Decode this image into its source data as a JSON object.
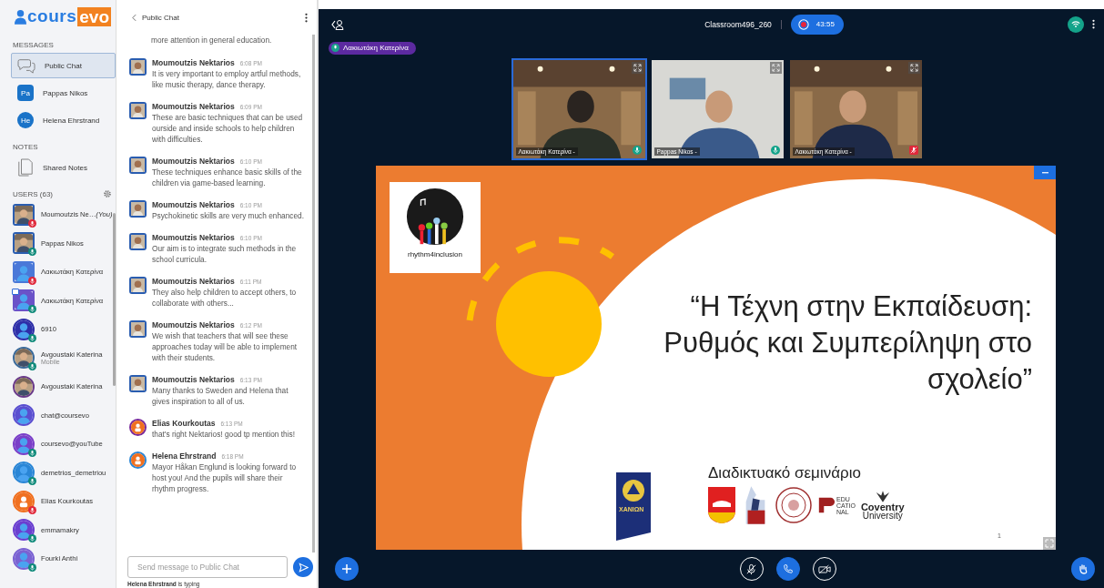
{
  "logo": {
    "part_a": "cours",
    "part_b": "evo"
  },
  "sidebar": {
    "messages_heading": "MESSAGES",
    "messages": [
      {
        "label": "Public Chat",
        "kind": "chat",
        "selected": true
      },
      {
        "label": "Pappas Nikos",
        "kind": "initials",
        "initials": "Pa",
        "moderator": true,
        "selected": false
      },
      {
        "label": "Helena Ehrstrand",
        "kind": "initials",
        "initials": "He",
        "moderator": false,
        "selected": false
      }
    ],
    "notes_heading": "NOTES",
    "notes": [
      {
        "label": "Shared Notes"
      }
    ],
    "users_heading": "USERS (63)",
    "users": [
      {
        "name": "Moumoutzis Ne…",
        "suffix": "(You)",
        "moderator": true,
        "color": "#2a5db0",
        "in_audio": true,
        "muted": true,
        "presenter": false
      },
      {
        "name": "Pappas Nikos",
        "moderator": true,
        "color": "#2a5db0",
        "in_audio": true,
        "muted": false,
        "presenter": false
      },
      {
        "name": "Λακιωτάκη Κατερίνα",
        "kind": "silhouette",
        "moderator": true,
        "color": "#4a78d8",
        "in_audio": true,
        "muted": true,
        "presenter": false
      },
      {
        "name": "Λακιωτάκη Κατερίνα",
        "kind": "silhouette",
        "moderator": true,
        "color": "#6a52c8",
        "in_audio": true,
        "muted": false,
        "presenter": true
      },
      {
        "name": "6910",
        "kind": "silhouette",
        "moderator": false,
        "color": "#2e2fa8",
        "in_audio": true,
        "muted": false,
        "presenter": false
      },
      {
        "name": "Avgoustaki Katerina",
        "sub": "Mobile",
        "moderator": false,
        "color": "#3a6a9a",
        "in_audio": true,
        "muted": false,
        "presenter": false
      },
      {
        "name": "Avgoustaki Katerina",
        "moderator": false,
        "color": "#6a3a8a",
        "in_audio": false,
        "presenter": false
      },
      {
        "name": "chat@coursevo",
        "kind": "silhouette",
        "moderator": false,
        "color": "#5a4fd0",
        "in_audio": false,
        "presenter": false
      },
      {
        "name": "coursevo@youTube",
        "kind": "silhouette",
        "moderator": false,
        "color": "#7a3fc8",
        "in_audio": true,
        "muted": false,
        "presenter": false
      },
      {
        "name": "demetrios_demetriou",
        "kind": "silhouette",
        "moderator": false,
        "color": "#2a86d6",
        "in_audio": true,
        "muted": false,
        "presenter": false
      },
      {
        "name": "Elias Kourkoutas",
        "kind": "person",
        "moderator": false,
        "color": "#f07020",
        "in_audio": true,
        "muted": true,
        "presenter": false
      },
      {
        "name": "emmamakry",
        "kind": "silhouette",
        "moderator": false,
        "color": "#6a3fd0",
        "in_audio": true,
        "muted": false,
        "presenter": false
      },
      {
        "name": "Fourki Anthi",
        "kind": "silhouette",
        "moderator": false,
        "color": "#7a62d2",
        "in_audio": true,
        "muted": false,
        "presenter": false
      }
    ]
  },
  "chat": {
    "title": "Public Chat",
    "messages": [
      {
        "kind": "continuation",
        "text": "more attention in general education."
      },
      {
        "author": "Moumoutzis Nektarios",
        "time": "6:08 PM",
        "text": "It is very important to employ artful methods, like music therapy, dance therapy."
      },
      {
        "author": "Moumoutzis Nektarios",
        "time": "6:09 PM",
        "text": "These are basic techniques that can be used ourside and inside schools to help children with difficulties."
      },
      {
        "author": "Moumoutzis Nektarios",
        "time": "6:10 PM",
        "text": "These techniques enhance basic skills of the children via game-based learning."
      },
      {
        "author": "Moumoutzis Nektarios",
        "time": "6:10 PM",
        "text": "Psychokinetic skills are very much enhanced."
      },
      {
        "author": "Moumoutzis Nektarios",
        "time": "6:10 PM",
        "text": "Our aim is to integrate such methods in the school curricula."
      },
      {
        "author": "Moumoutzis Nektarios",
        "time": "6:11 PM",
        "text": "They also help children to accept others, to collaborate with others..."
      },
      {
        "author": "Moumoutzis Nektarios",
        "time": "6:12 PM",
        "text": "We wish that teachers that will see these approaches today will be able to implement with their students."
      },
      {
        "author": "Moumoutzis Nektarios",
        "time": "6:13 PM",
        "text": "Many thanks to Sweden and Helena that gives inspiration to all of us."
      },
      {
        "kind": "person",
        "author": "Elias Kourkoutas",
        "time": "6:13 PM",
        "color": "#7a2a9a",
        "text": "that's right Nektarios! good tp mention this!"
      },
      {
        "kind": "person",
        "author": "Helena Ehrstrand",
        "time": "6:18 PM",
        "color": "#2a86d6",
        "text": "Mayor Håkan Englund is looking forward to host you! And the pupils will share their rhythm progress."
      }
    ],
    "input": {
      "placeholder": "Send message to Public Chat"
    },
    "typing": "**Helena Ehrstrand** is typing"
  },
  "meeting": {
    "room": "Classroom496_260",
    "recording": true,
    "timer": "43:55",
    "talker": "Λακιωτάκη Κατερίνα",
    "tiles": [
      {
        "name": "Λακιωτάκη Κατερίνα -",
        "muted": false,
        "selected": true
      },
      {
        "name": "Pappas Nikos -",
        "muted": false,
        "selected": false
      },
      {
        "name": "Λακιωτάκη Κατερίνα -",
        "muted": true,
        "selected": false
      }
    ],
    "slide": {
      "logo_text": "rhythm4inclusion",
      "title_lines": [
        "“Η Τέχνη στην Εκπαίδευση:",
        "Ρυθμός και Συμπερίληψη στο",
        "σχολείο”"
      ],
      "subtitle": "Διαδικτυακό σεμινάριο",
      "emblem_text": "ΧΑΝΙΩΝ",
      "edu_lines": [
        "EDU",
        "CATIO",
        "NAL"
      ],
      "coventry_lines": [
        "Coventry",
        "University"
      ],
      "page": "1"
    },
    "controls": [
      {
        "kind": "mic",
        "active": false
      },
      {
        "kind": "phone",
        "active": true
      },
      {
        "kind": "camera",
        "active": false
      }
    ]
  }
}
